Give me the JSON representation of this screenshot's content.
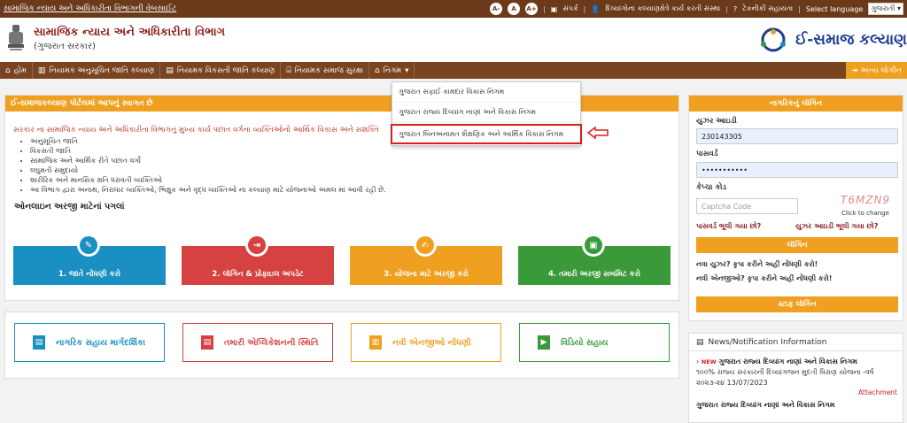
{
  "topbar": {
    "site_link": "સામાજિક ન્યાય અને અધિકારીતા વિભાગની વેબસાઈટ",
    "font_small": "A-",
    "font_normal": "A",
    "font_large": "A+",
    "contact": "સંપર્ક",
    "divyang_link": "દિવ્યાંગોના કલ્યાણક્ષેત્રે કાર્ય કરતી સંસ્થા",
    "tech_help": "ટેકનીકી સહાયતા",
    "select_language": "Select language",
    "language_value": "ગુજરાતી"
  },
  "header": {
    "dept_title": "સામાજિક ન્યાય અને અધિકારીતા વિભાગ",
    "dept_sub": "(ગુજરાત સરકાર)",
    "brand": "ઈ-સમાજ કલ્યાણ"
  },
  "nav": {
    "home": "હોમ",
    "sc_welfare": "નિયામક અનુસૂચિત જાતિ કલ્યાણ",
    "developing_castes": "નિયામક વિકસતી જાતિ કલ્યાણ",
    "social_security": "નિયામક સમાજ સુરક્ષા",
    "nigam": "નિગમ",
    "other_login": "અન્ય લોગીન"
  },
  "dropdown": {
    "items": [
      "ગુજરાત સફાઈ કામદાર વિકાસ નિગમ",
      "ગુજરાત રાજ્ય દિવ્યાંગ નાણાં અને વિકાસ નિગમ",
      "ગુજરાત બિનઅનામત શૈક્ષણિક અને આર્થિક વિકાસ નિગમ"
    ]
  },
  "welcome": {
    "heading": "ઈ-સમાજકલ્યાણ પોર્ટલમાં આપનું સ્વાગત છે",
    "intro": "સરકાર ના સામાજિક ન્યાય અને અધિકારીતા વિભાગનું મુખ્ય કાર્ય પછાત વર્ગના વ્યક્તિઓનો આર્થિક વિકાસ અને સશક્તિ",
    "bullets": [
      "અનુસૂચિત જાતિ",
      "વિકસતી જાતિ",
      "સામાજિક અને આર્થિક રીતે પછાત વર્ગો",
      "લઘુમતી સમુદાયો",
      "શારીરિક અને માનસિક ક્ષતિ ધરાવતી વ્યક્તિઓ",
      "આ વિભાગ દ્વારા અનાથ, નિરાધાર વ્યક્તિઓ, ભિક્ષુક અને વૃદ્ધ વ્યક્તિઓ ના કલ્યાણ માટે યોજનાઓ અમલ માં આવી રહી છે."
    ],
    "steps_title": "ઓનલાઇન અરજી માટેનાં પગલાં",
    "steps": [
      "1. જાતે નોંધણી કરો",
      "2. લૉગિન & પ્રોફાઇલ અપડેટ",
      "3. યોજના માટે અરજી કરો",
      "4. તમારી અરજી સબમિટ કરો"
    ]
  },
  "quick_links": [
    "નાગરિક સહાય માર્ગદર્શિકા",
    "તમારી એપ્લિકેશનની સ્થિતિ",
    "નવી એનજીઓ નોંધણી",
    "વિડિયો સહાય"
  ],
  "login": {
    "heading": "નાગરિકનું લૉગિન",
    "user_id_label": "યુઝર આઇડી",
    "user_id_value": "230143305",
    "password_label": "પાસવર્ડ",
    "password_value": "•••••••••••",
    "captcha_label": "કેપ્ચા કોડ",
    "captcha_placeholder": "Captcha Code",
    "captcha_text": "T6MZN9",
    "click_to_change": "Click to change",
    "forgot_password": "પાસવર્ડ ભૂલી ગયા છો?",
    "forgot_userid": "યુઝર આઇડી ભૂલી ગયા છો?",
    "login_button": "લૉગિન",
    "new_user": "નવા યુઝર? કૃપા કરીને અહીં નોંધણી કરો!",
    "new_ngo": "નવી એનજીઓ? કૃપા કરીને અહીં નોંધણી કરો!",
    "staff_login": "સ્ટાફ લૉગિન"
  },
  "news": {
    "heading": "News/Notification Information",
    "new_badge": "NEW",
    "title": "ગુજરાત રાજ્ય દિવ્યાંગ નાણાં અને વિકાસ નિગમ",
    "desc": "૧૦૦% રાજ્ય સરકારની દિવ્યાંગજન મુદતી ધિરાણ યોજના -વર્ષ ૨૦૨૩-૨૪ 13/07/2023",
    "attachment": "Attachment",
    "next_title": "ગુજરાત રાજ્ય દિવ્યાંગ નાણાં અને વિકાસ નિગમ"
  },
  "colors": {
    "topbar": "#6b3a1a",
    "navbar": "#7a4421",
    "accent": "#f0a020",
    "step1": "#1a8fc2",
    "step2": "#d64141",
    "step3": "#f0a020",
    "step4": "#3a9a3a",
    "highlight": "#d32020"
  }
}
